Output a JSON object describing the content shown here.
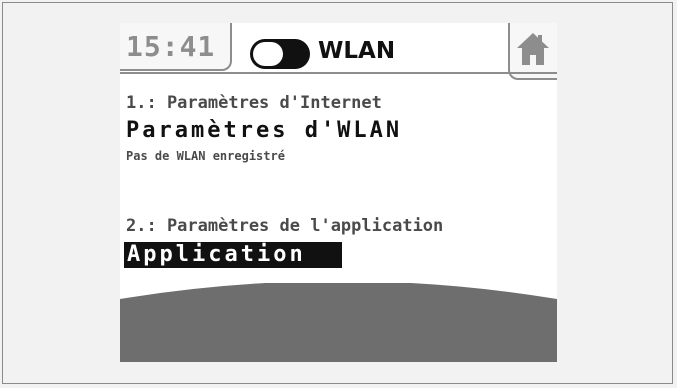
{
  "status": {
    "time": "15:41",
    "wlan_toggle_on": true,
    "title": "WLAN"
  },
  "menu": {
    "items": [
      {
        "number_label": "1.: Paramètres d'Internet",
        "title": "Paramètres d'WLAN",
        "subtitle": "Pas de WLAN enregistré",
        "selected": false
      },
      {
        "number_label": "2.: Paramètres de l'application",
        "title": "Application",
        "selected": true
      }
    ]
  },
  "icons": {
    "home": "home-icon",
    "toggle": "wlan-toggle"
  },
  "colors": {
    "screen_background": "#ffffff",
    "footer_gray": "#6e6e6e",
    "border_gray": "#8d8d8d",
    "text_dark": "#111111",
    "selection_background": "#111111"
  }
}
